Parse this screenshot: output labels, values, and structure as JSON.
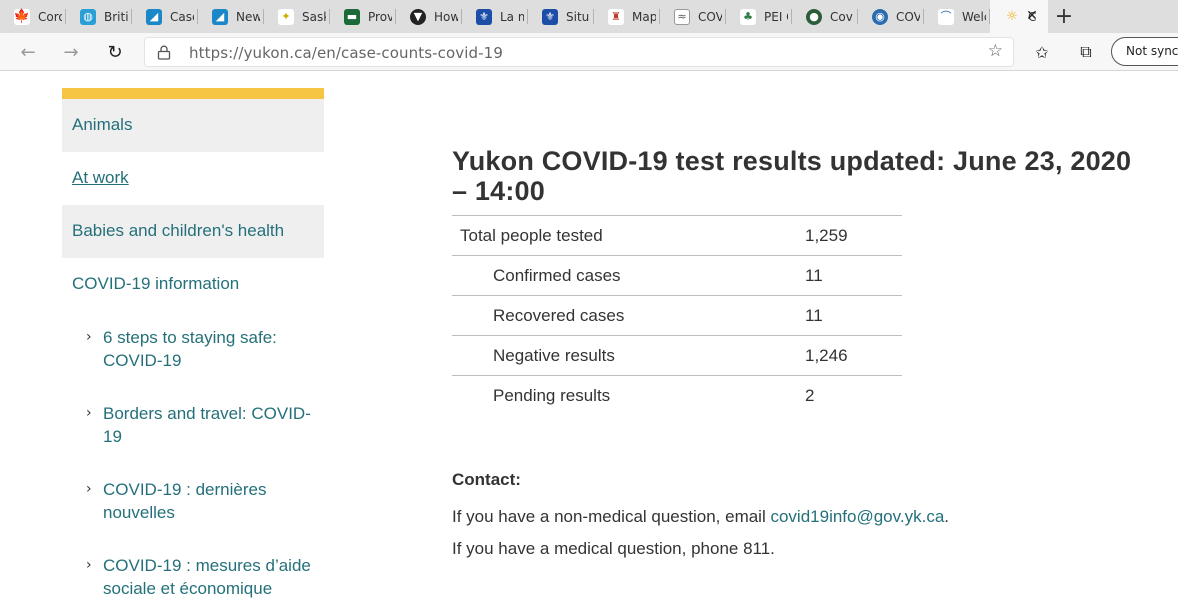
{
  "browser": {
    "tabs": [
      {
        "title": "Coror",
        "icon": "maple-leaf-icon",
        "color": "#d52b1e"
      },
      {
        "title": "Britisl",
        "icon": "bc-icon",
        "color": "#2a9fd6"
      },
      {
        "title": "Cases",
        "icon": "alberta-icon",
        "color": "#1a87c9"
      },
      {
        "title": "News",
        "icon": "alberta-icon",
        "color": "#1a87c9"
      },
      {
        "title": "Saska",
        "icon": "sask-icon",
        "color": "#e2c91f"
      },
      {
        "title": "Provi",
        "icon": "manitoba-icon",
        "color": "#1b6a3a"
      },
      {
        "title": "How",
        "icon": "ontario-icon",
        "color": "#222222"
      },
      {
        "title": "La ma",
        "icon": "quebec-icon",
        "color": "#1c4ea8"
      },
      {
        "title": "Situat",
        "icon": "quebec-icon",
        "color": "#1c4ea8"
      },
      {
        "title": "Maps",
        "icon": "nb-icon",
        "color": "#c0392b"
      },
      {
        "title": "COVII",
        "icon": "ns-icon",
        "color": "#555555"
      },
      {
        "title": "PEI C",
        "icon": "pei-icon",
        "color": "#2d7d46"
      },
      {
        "title": "Covic",
        "icon": "nl-icon",
        "color": "#2b5d3a"
      },
      {
        "title": "COVII",
        "icon": "nwt-icon",
        "color": "#2b6cb0"
      },
      {
        "title": "Welco",
        "icon": "nunavut-icon",
        "color": "#1f5fa8"
      },
      {
        "title": "C",
        "icon": "yukon-icon",
        "color": "#f2a900"
      }
    ],
    "url": "https://yukon.ca/en/case-counts-covid-19",
    "sync_label": "Not syncing"
  },
  "sidebar": {
    "items": [
      {
        "label": "Animals"
      },
      {
        "label": "At work"
      },
      {
        "label": "Babies and children's health"
      },
      {
        "label": "COVID-19 information"
      }
    ],
    "subitems": [
      {
        "label": "6 steps to staying safe: COVID-19"
      },
      {
        "label": "Borders and travel: COVID-19"
      },
      {
        "label": "COVID-19 : dernières nouvelles"
      },
      {
        "label": "COVID-19 : mesures d’aide sociale et économique"
      }
    ]
  },
  "main": {
    "title": "Yukon COVID-19 test results updated: June 23, 2020 – 14:00",
    "results": [
      {
        "label": "Total people tested",
        "value": "1,259"
      },
      {
        "label": "Confirmed cases",
        "value": "11"
      },
      {
        "label": "Recovered cases",
        "value": "11"
      },
      {
        "label": "Negative results",
        "value": "1,246"
      },
      {
        "label": "Pending results",
        "value": "2"
      }
    ],
    "contact": {
      "heading": "Contact:",
      "email_prefix": "If you have a non-medical question, email ",
      "email": "covid19info@gov.yk.ca",
      "email_suffix": ".",
      "phone_text": "If you have a medical question, phone 811."
    }
  },
  "colors": {
    "accent_yellow": "#f7c544",
    "link_teal": "#24707a",
    "shaded_bg": "#efefef"
  }
}
